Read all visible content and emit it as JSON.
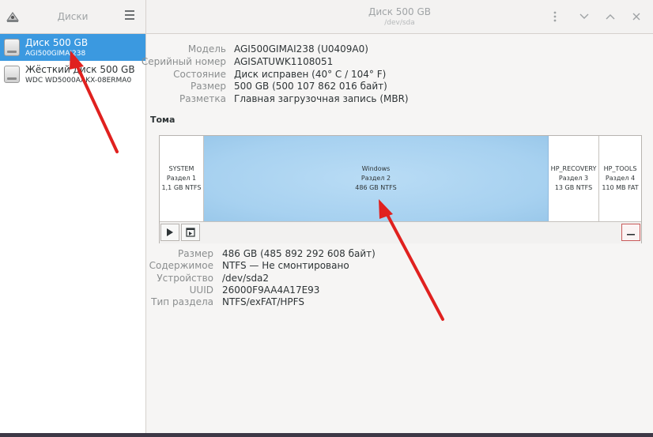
{
  "sidebar": {
    "title": "Диски",
    "drives": [
      {
        "name": "Диск 500 GB",
        "model": "AGI500GIMAI238",
        "selected": true
      },
      {
        "name": "Жёсткий диск 500 GB",
        "model": "WDC WD5000AAKX-08ERMA0",
        "selected": false
      }
    ]
  },
  "header": {
    "title": "Диск 500 GB",
    "subtitle": "/dev/sda",
    "icons": [
      "kebab-menu-icon",
      "chevron-down-icon",
      "chevron-up-icon",
      "close-icon"
    ]
  },
  "disk_info": [
    {
      "label": "Модель",
      "value": "AGI500GIMAI238 (U0409A0)"
    },
    {
      "label": "Серийный номер",
      "value": "AGISATUWK1108051"
    },
    {
      "label": "Состояние",
      "value": "Диск исправен (40° C / 104° F)"
    },
    {
      "label": "Размер",
      "value": "500 GB (500 107 862 016 байт)"
    },
    {
      "label": "Разметка",
      "value": "Главная загрузочная запись (MBR)"
    }
  ],
  "volumes": {
    "heading": "Тома",
    "partitions": [
      {
        "name": "SYSTEM",
        "part": "Раздел 1",
        "size": "1,1 GB NTFS",
        "selected": false
      },
      {
        "name": "Windows",
        "part": "Раздел 2",
        "size": "486 GB NTFS",
        "selected": true
      },
      {
        "name": "HP_RECOVERY",
        "part": "Раздел 3",
        "size": "13 GB NTFS",
        "selected": false
      },
      {
        "name": "HP_TOOLS",
        "part": "Раздел 4",
        "size": "110 MB FAT",
        "selected": false
      }
    ],
    "toolbar_icons": [
      "play-icon",
      "mount-icon",
      "minus-icon"
    ]
  },
  "volume_details": [
    {
      "label": "Размер",
      "value": "486 GB (485 892 292 608 байт)"
    },
    {
      "label": "Содержимое",
      "value": "NTFS — Не смонтировано"
    },
    {
      "label": "Устройство",
      "value": "/dev/sda2"
    },
    {
      "label": "UUID",
      "value": "26000F9AA4A17E93"
    },
    {
      "label": "Тип раздела",
      "value": "NTFS/exFAT/HPFS"
    }
  ],
  "colors": {
    "selection": "#3b99e0",
    "partition_selected": "#a7d1f0",
    "annotation_arrow": "#e0211f"
  }
}
